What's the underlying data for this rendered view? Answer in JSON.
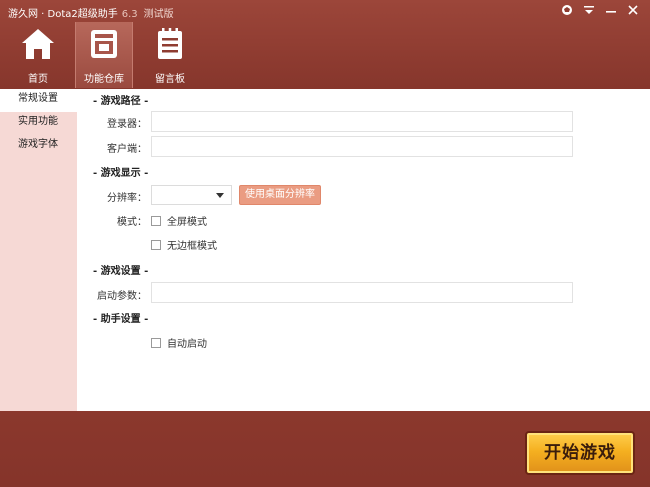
{
  "window": {
    "title": "游久网 · Dota2超级助手",
    "version": "6.3",
    "edition": "测试版"
  },
  "nav": [
    {
      "label": "首页",
      "icon": "home-icon"
    },
    {
      "label": "功能仓库",
      "icon": "warehouse-icon"
    },
    {
      "label": "留言板",
      "icon": "notepad-icon"
    }
  ],
  "sidebar": {
    "items": [
      {
        "label": "常规设置"
      },
      {
        "label": "实用功能"
      },
      {
        "label": "游戏字体"
      }
    ]
  },
  "sections": {
    "path": {
      "title": "- 游戏路径 -",
      "launcher_label": "登录器：",
      "launcher_value": "",
      "client_label": "客户端：",
      "client_value": ""
    },
    "display": {
      "title": "- 游戏显示 -",
      "resolution_label": "分辨率：",
      "resolution_value": "",
      "desktop_res_button": "使用桌面分辨率",
      "mode_label": "模式：",
      "fullscreen_label": "全屏模式",
      "borderless_label": "无边框模式"
    },
    "game": {
      "title": "- 游戏设置 -",
      "params_label": "启动参数：",
      "params_value": ""
    },
    "helper": {
      "title": "- 助手设置 -",
      "autostart_label": "自动启动"
    }
  },
  "footer": {
    "start_button": "开始游戏"
  },
  "colors": {
    "header_bg": "#8f3c31",
    "sidebar_bg": "#f6d9d5",
    "button_accent": "#ea9c82",
    "start_button": "#f5b020"
  }
}
